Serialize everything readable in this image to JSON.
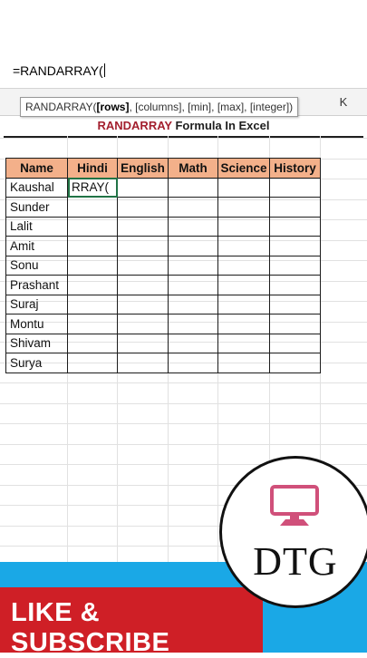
{
  "formula_bar": {
    "text": "=RANDARRAY("
  },
  "tooltip": {
    "fn_name": "RANDARRAY(",
    "current_arg": "[rows]",
    "rest_args": ", [columns], [min], [max], [integer])"
  },
  "column_header": {
    "label": "K"
  },
  "sheet_title": {
    "highlight": "RANDARRAY",
    "rest": " Formula In Excel"
  },
  "table": {
    "headers": [
      "Name",
      "Hindi",
      "English",
      "Math",
      "Science",
      "History"
    ],
    "rows": [
      [
        "Kaushal",
        "RRAY(",
        "",
        "",
        "",
        ""
      ],
      [
        "Sunder",
        "",
        "",
        "",
        "",
        ""
      ],
      [
        "Lalit",
        "",
        "",
        "",
        "",
        ""
      ],
      [
        "Amit",
        "",
        "",
        "",
        "",
        ""
      ],
      [
        "Sonu",
        "",
        "",
        "",
        "",
        ""
      ],
      [
        "Prashant",
        "",
        "",
        "",
        "",
        ""
      ],
      [
        "Suraj",
        "",
        "",
        "",
        "",
        ""
      ],
      [
        "Montu",
        "",
        "",
        "",
        "",
        ""
      ],
      [
        "Shivam",
        "",
        "",
        "",
        "",
        ""
      ],
      [
        "Surya",
        "",
        "",
        "",
        "",
        ""
      ]
    ]
  },
  "banner": {
    "subscribe": "LIKE & SUBSCRIBE"
  },
  "logo": {
    "text": "DTG",
    "icon": "monitor-icon"
  },
  "colors": {
    "header_fill": "#f3b08a",
    "title_accent": "#a31f2e",
    "banner_red": "#cf1f26",
    "banner_cyan": "#1aa8e6",
    "active_cell": "#217346",
    "logo_icon": "#d0507a"
  }
}
